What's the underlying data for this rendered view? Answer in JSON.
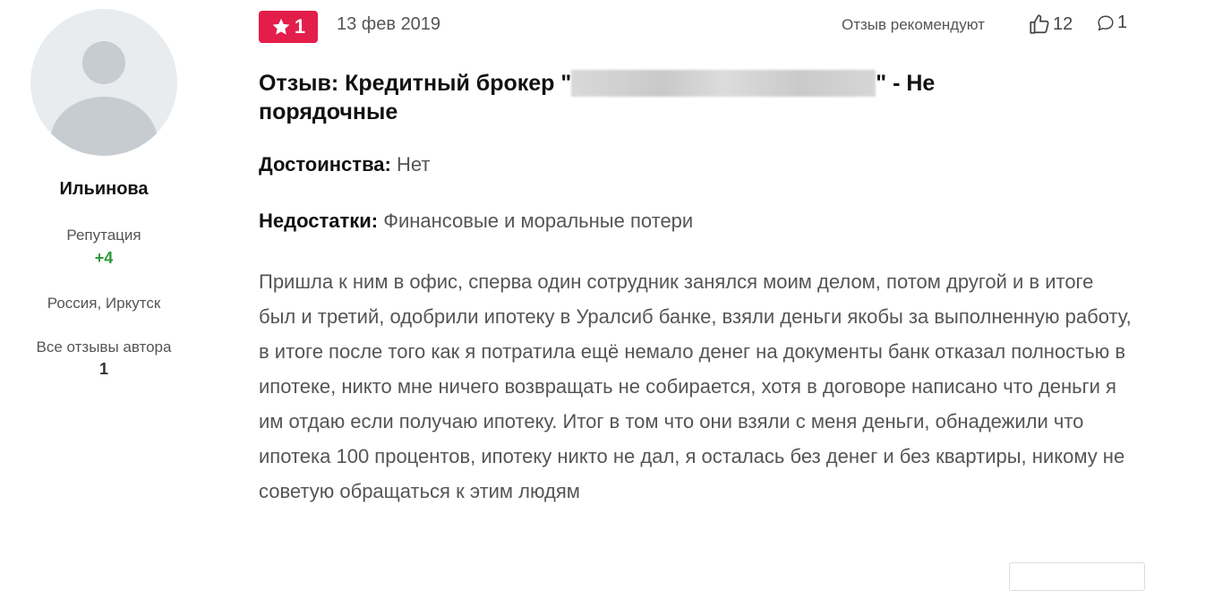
{
  "author": {
    "name": "Ильинова",
    "reputation_label": "Репутация",
    "reputation_value": "+4",
    "location": "Россия, Иркутск",
    "all_reviews_label": "Все отзывы автора",
    "all_reviews_count": "1"
  },
  "review": {
    "rating": "1",
    "date": "13 фев 2019",
    "recommend_label": "Отзыв рекомендуют",
    "likes": "12",
    "comments": "1",
    "title_prefix": "Отзыв: Кредитный брокер \"",
    "title_suffix": "\" - Не порядочные",
    "pros_label": "Достоинства:",
    "pros": " Нет",
    "cons_label": "Недостатки:",
    "cons": " Финансовые и моральные потери",
    "body": "Пришла к ним в офис, сперва один сотрудник занялся моим делом, потом другой и в итоге был и третий, одобрили ипотеку в Уралсиб банке, взяли деньги якобы за выполненную работу, в итоге после того как я потратила ещё немало денег на документы банк отказал полностью в ипотеке, никто мне ничего возвращать не собирается, хотя в договоре написано что деньги я им отдаю если получаю ипотеку. Итог в том что они взяли с меня деньги, обнадежили что ипотека 100 процентов, ипотеку никто не дал, я осталась без денег и без квартиры, никому не советую обращаться к этим людям"
  },
  "icons": {
    "star": "star-icon",
    "like": "thumbs-up-icon",
    "comment": "comment-icon",
    "avatar": "user-avatar-placeholder"
  },
  "colors": {
    "badge": "#e31e4a",
    "reputation": "#2e9b3a"
  }
}
